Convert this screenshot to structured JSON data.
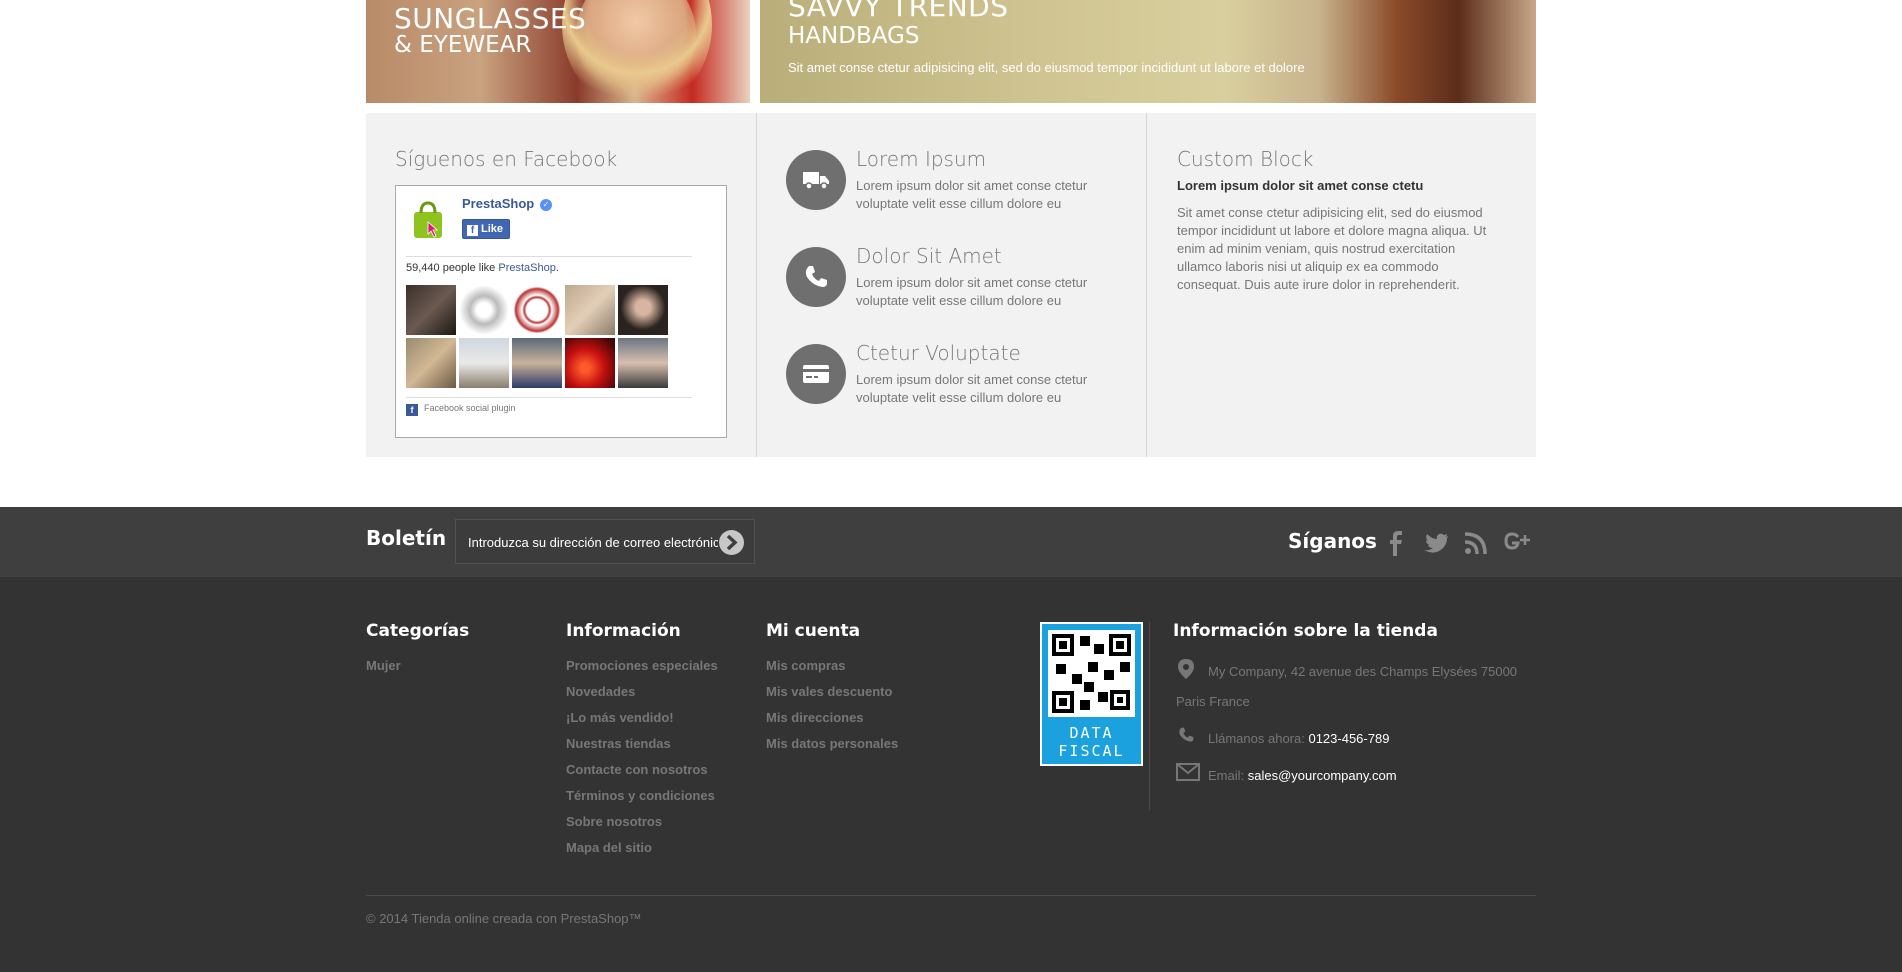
{
  "banners": {
    "left": {
      "title_line1": "SUNGLASSES",
      "title_line2": "& EYEWEAR"
    },
    "right": {
      "title_line1": "SAVVY TRENDS",
      "title_line2": "HANDBAGS",
      "subtitle": "Sit amet conse ctetur adipisicing elit, sed do eiusmod tempor incididunt ut labore et dolore"
    }
  },
  "facebook": {
    "heading": "Síguenos en Facebook",
    "page_name": "PrestaShop",
    "like_label": "Like",
    "likes_count": "59,440 people like",
    "likes_page": "PrestaShop",
    "plugin_label": "Facebook social plugin"
  },
  "features": [
    {
      "icon": "truck-icon",
      "title": "Lorem Ipsum",
      "line1": "Lorem ipsum dolor sit amet conse ctetur",
      "line2": "voluptate velit esse cillum dolore eu"
    },
    {
      "icon": "phone-icon",
      "title": "Dolor Sit Amet",
      "line1": "Lorem ipsum dolor sit amet conse ctetur",
      "line2": "voluptate velit esse cillum dolore eu"
    },
    {
      "icon": "credit-card-icon",
      "title": "Ctetur Voluptate",
      "line1": "Lorem ipsum dolor sit amet conse ctetur",
      "line2": "voluptate velit esse cillum dolore eu"
    }
  ],
  "custom_block": {
    "title": "Custom Block",
    "subtitle": "Lorem ipsum dolor sit amet conse ctetu",
    "text": "Sit amet conse ctetur adipisicing elit, sed do eiusmod tempor incididunt ut labore et dolore magna aliqua. Ut enim ad minim veniam, quis nostrud exercitation ullamco laboris nisi ut aliquip ex ea commodo consequat. Duis aute irure dolor in reprehenderit."
  },
  "newsletter": {
    "title": "Boletín",
    "placeholder": "Introduzca su dirección de correo electrónico"
  },
  "follow": {
    "title": "Síganos",
    "networks": [
      "facebook-icon",
      "twitter-icon",
      "rss-icon",
      "google-plus-icon"
    ]
  },
  "footer": {
    "categories": {
      "title": "Categorías",
      "items": [
        "Mujer"
      ]
    },
    "information": {
      "title": "Información",
      "items": [
        "Promociones especiales",
        "Novedades",
        "¡Lo más vendido!",
        "Nuestras tiendas",
        "Contacte con nosotros",
        "Términos y condiciones",
        "Sobre nosotros",
        "Mapa del sitio"
      ]
    },
    "account": {
      "title": "Mi cuenta",
      "items": [
        "Mis compras",
        "Mis vales descuento",
        "Mis direcciones",
        "Mis datos personales"
      ]
    },
    "qr": {
      "line1": "DATA",
      "line2": "FISCAL"
    },
    "store": {
      "title": "Información sobre la tienda",
      "address_line1": "My Company, 42 avenue des Champs Elysées 75000",
      "address_line2": "Paris France",
      "phone_label": "Llámanos ahora:",
      "phone": "0123-456-789",
      "email_label": "Email:",
      "email": "sales@yourcompany.com"
    },
    "copyright": "© 2014 Tienda online creada con PrestaShop™"
  }
}
